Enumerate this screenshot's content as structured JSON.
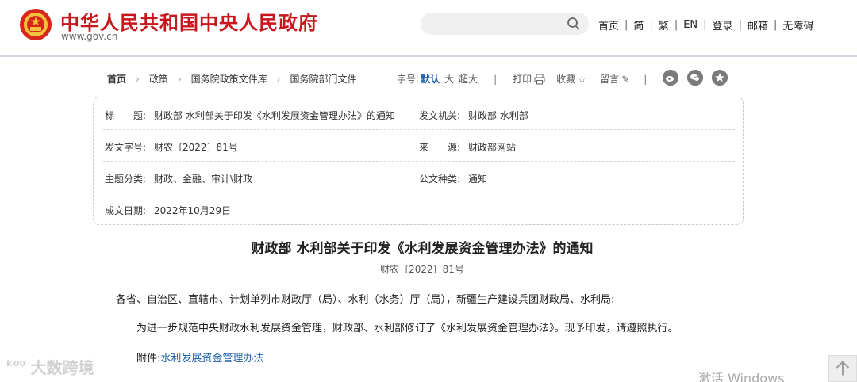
{
  "header": {
    "site_name": "中华人民共和国中央人民政府",
    "site_url": "www.gov.cn",
    "nav": [
      "首页",
      "简",
      "繁",
      "EN",
      "登录",
      "邮箱",
      "无障碍"
    ]
  },
  "breadcrumb": [
    "首页",
    "政策",
    "国务院政策文件库",
    "国务院部门文件"
  ],
  "tools": {
    "font_label": "字号:",
    "font_default": "默认",
    "font_large": "大",
    "font_xlarge": "超大",
    "print": "打印",
    "favorite": "收藏",
    "comment": "留言"
  },
  "info": {
    "title_key": "标　　题:",
    "title_val": "财政部 水利部关于印发《水利发展资金管理办法》的通知",
    "issuer_key": "发文机关:",
    "issuer_val": "财政部 水利部",
    "docno_key": "发文字号:",
    "docno_val": "财农〔2022〕81号",
    "source_key": "来　　源:",
    "source_val": "财政部网站",
    "topic_key": "主题分类:",
    "topic_val": "财政、金融、审计\\财政",
    "type_key": "公文种类:",
    "type_val": "通知",
    "date_key": "成文日期:",
    "date_val": "2022年10月29日"
  },
  "article": {
    "title": "财政部 水利部关于印发《水利发展资金管理办法》的通知",
    "docno": "财农〔2022〕81号",
    "greeting": "各省、自治区、直辖市、计划单列市财政厅（局）、水利（水务）厅（局），新疆生产建设兵团财政局、水利局:",
    "body": "为进一步规范中央财政水利发展资金管理，财政部、水利部修订了《水利发展资金管理办法》。现予印发，请遵照执行。",
    "attach_label": "附件:",
    "attach_link": "水利发展资金管理办法"
  },
  "watermark": "大数跨境",
  "activate": "激活 Windows",
  "colors": {
    "brand_red": "#c8161d",
    "link_blue": "#1d5fae"
  }
}
